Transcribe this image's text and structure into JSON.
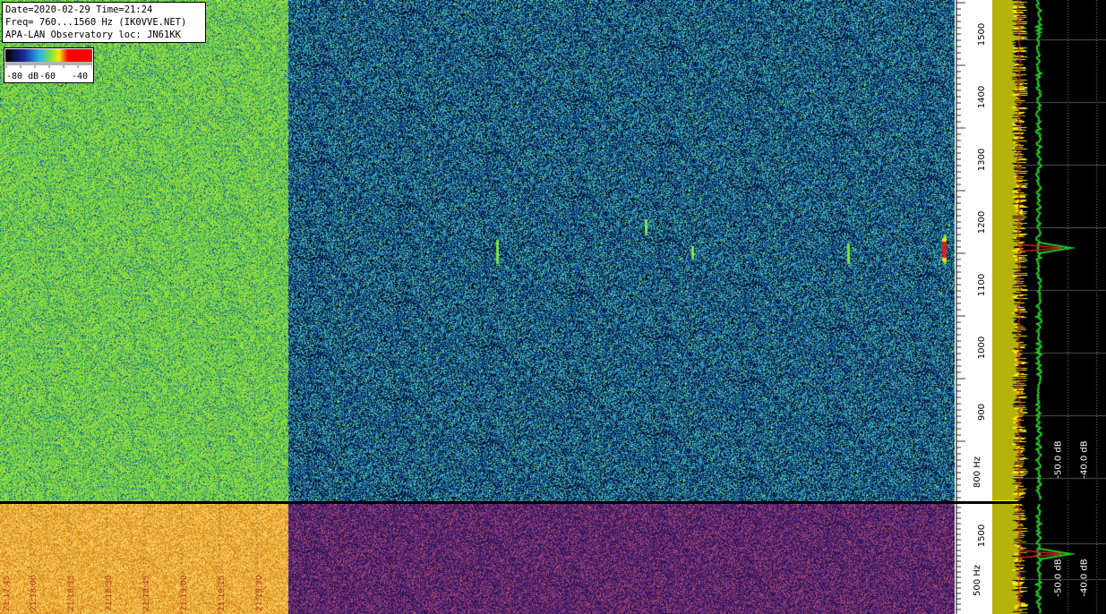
{
  "info": {
    "line1": "Date=2020-02-29 Time=21:24",
    "line2": "Freq= 760...1560 Hz (IK0VVE.NET)",
    "line3": "APA-LAN Observatory loc: JN61KK"
  },
  "colorbar": {
    "labels": [
      "-80 dB",
      "-60",
      "-40"
    ],
    "colors": [
      "#000000",
      "#1a2aa0",
      "#2fb6e8",
      "#7be24a",
      "#f2e800",
      "#ff0000"
    ]
  },
  "freq_axis_top": {
    "ticks": [
      "1500",
      "1400",
      "1300",
      "1200",
      "1100",
      "1000",
      "900",
      "800 Hz"
    ]
  },
  "freq_axis_bottom": {
    "ticks": [
      "1500",
      "500 Hz"
    ]
  },
  "spectrum_top": {
    "db_labels": [
      "-50.0 dB",
      "-40.0 dB"
    ]
  },
  "spectrum_bottom": {
    "db_labels": [
      "-50.0 dB",
      "-40.0 dB"
    ]
  },
  "time_axis": {
    "labels": [
      "21:17:45",
      "21:18:00",
      "21:18:15",
      "21:18:30",
      "21:18:45",
      "21:19:00",
      "21:19:15",
      "21:19:30"
    ]
  },
  "colors": {
    "waterfall_bg_green": "#3cb84a",
    "waterfall_bg_blue": "#123a7a",
    "spectrum_yellow": "#f4ef00",
    "spectrum_green": "#22cc22",
    "spectrum_red": "#d22020",
    "bottom_orange": "#e89a1a",
    "bottom_purple": "#4a2370"
  }
}
